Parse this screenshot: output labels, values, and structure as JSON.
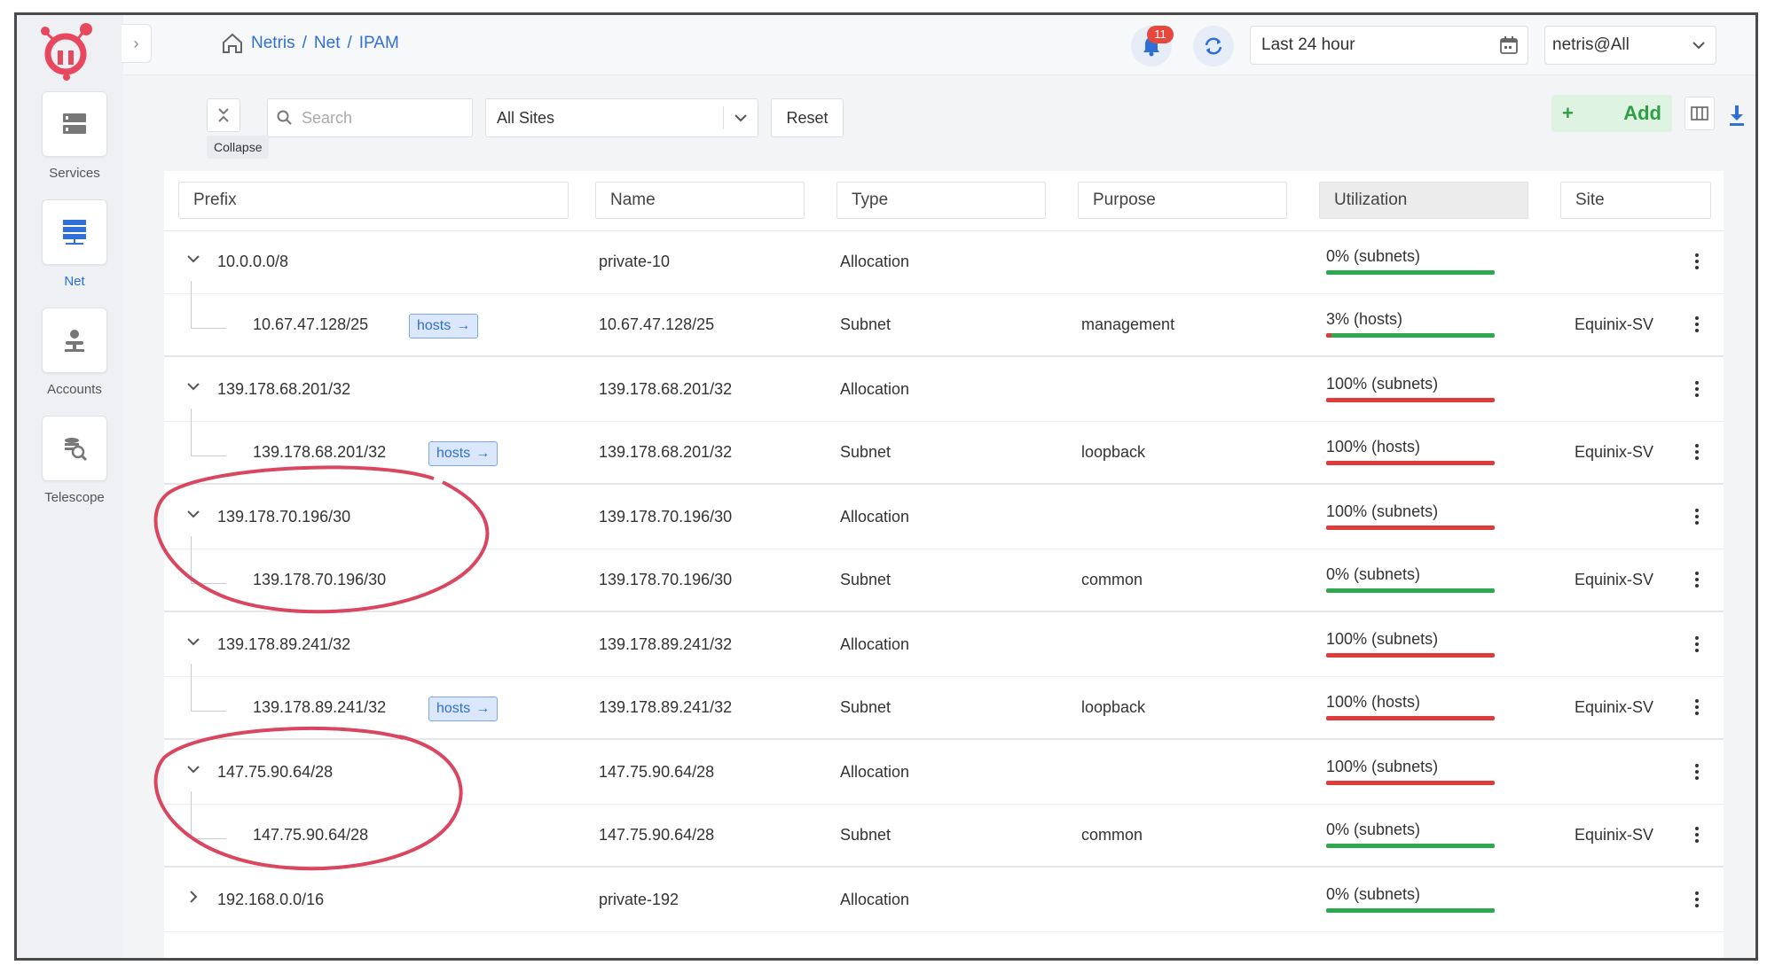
{
  "sidebar": {
    "items": [
      {
        "label": "Services",
        "icon": "server-icon",
        "active": false
      },
      {
        "label": "Net",
        "icon": "network-icon",
        "active": true
      },
      {
        "label": "Accounts",
        "icon": "accounts-icon",
        "active": false
      },
      {
        "label": "Telescope",
        "icon": "telescope-icon",
        "active": false
      }
    ]
  },
  "header": {
    "breadcrumb": [
      "Netris",
      "Net",
      "IPAM"
    ],
    "notification_count": "11",
    "time_range": "Last 24 hour",
    "user": "netris@All"
  },
  "toolbar": {
    "collapse_tooltip": "Collapse",
    "search_placeholder": "Search",
    "site_filter": "All Sites",
    "reset_label": "Reset",
    "add_label": "Add"
  },
  "table": {
    "columns": [
      "Prefix",
      "Name",
      "Type",
      "Purpose",
      "Utilization",
      "Site"
    ],
    "rows": [
      {
        "prefix": "10.0.0.0/8",
        "name": "private-10",
        "type": "Allocation",
        "purpose": "",
        "utilization": "0% (subnets)",
        "util_status": "green",
        "site": ""
      },
      {
        "prefix": "10.67.47.128/25",
        "hosts_tag": "hosts",
        "name": "10.67.47.128/25",
        "type": "Subnet",
        "purpose": "management",
        "utilization": "3% (hosts)",
        "util_status": "mixed",
        "site": "Equinix-SV"
      },
      {
        "prefix": "139.178.68.201/32",
        "name": "139.178.68.201/32",
        "type": "Allocation",
        "purpose": "",
        "utilization": "100% (subnets)",
        "util_status": "red",
        "site": ""
      },
      {
        "prefix": "139.178.68.201/32",
        "hosts_tag": "hosts",
        "name": "139.178.68.201/32",
        "type": "Subnet",
        "purpose": "loopback",
        "utilization": "100% (hosts)",
        "util_status": "red",
        "site": "Equinix-SV"
      },
      {
        "prefix": "139.178.70.196/30",
        "name": "139.178.70.196/30",
        "type": "Allocation",
        "purpose": "",
        "utilization": "100% (subnets)",
        "util_status": "red",
        "site": ""
      },
      {
        "prefix": "139.178.70.196/30",
        "name": "139.178.70.196/30",
        "type": "Subnet",
        "purpose": "common",
        "utilization": "0% (subnets)",
        "util_status": "green",
        "site": "Equinix-SV"
      },
      {
        "prefix": "139.178.89.241/32",
        "name": "139.178.89.241/32",
        "type": "Allocation",
        "purpose": "",
        "utilization": "100% (subnets)",
        "util_status": "red",
        "site": ""
      },
      {
        "prefix": "139.178.89.241/32",
        "hosts_tag": "hosts",
        "name": "139.178.89.241/32",
        "type": "Subnet",
        "purpose": "loopback",
        "utilization": "100% (hosts)",
        "util_status": "red",
        "site": "Equinix-SV"
      },
      {
        "prefix": "147.75.90.64/28",
        "name": "147.75.90.64/28",
        "type": "Allocation",
        "purpose": "",
        "utilization": "100% (subnets)",
        "util_status": "red",
        "site": ""
      },
      {
        "prefix": "147.75.90.64/28",
        "name": "147.75.90.64/28",
        "type": "Subnet",
        "purpose": "common",
        "utilization": "0% (subnets)",
        "util_status": "green",
        "site": "Equinix-SV"
      },
      {
        "prefix": "192.168.0.0/16",
        "name": "private-192",
        "type": "Allocation",
        "purpose": "",
        "utilization": "0% (subnets)",
        "util_status": "green",
        "site": ""
      }
    ]
  },
  "colors": {
    "accent": "#2f6fd6",
    "ok": "#2fa84f",
    "full": "#de3b3b",
    "annotation": "#d9465f",
    "add": "#2f9e44"
  }
}
